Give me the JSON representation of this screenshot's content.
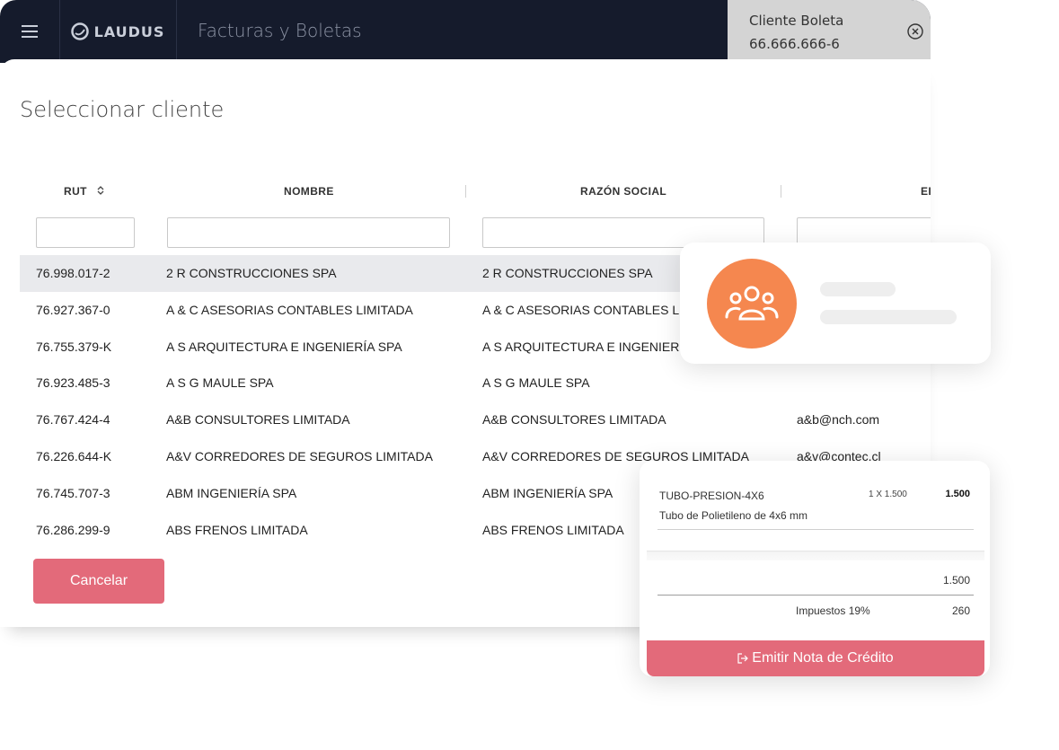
{
  "app": {
    "brand": "LAUDUS",
    "title": "Facturas y Boletas",
    "client_pill": {
      "name": "Cliente Boleta",
      "rut": "66.666.666-6"
    }
  },
  "modal": {
    "title": "Seleccionar cliente",
    "columns": {
      "rut": "RUT",
      "nombre": "NOMBRE",
      "razon": "RAZÓN SOCIAL",
      "email": "EI"
    },
    "rows": [
      {
        "rut": "76.998.017-2",
        "nombre": "2 R CONSTRUCCIONES SPA",
        "razon": "2 R CONSTRUCCIONES SPA",
        "email": ""
      },
      {
        "rut": "76.927.367-0",
        "nombre": "A & C ASESORIAS CONTABLES LIMITADA",
        "razon": "A & C ASESORIAS CONTABLES LIMITADA",
        "email": ""
      },
      {
        "rut": "76.755.379-K",
        "nombre": "A S ARQUITECTURA E INGENIERÍA SPA",
        "razon": "A S ARQUITECTURA E INGENIERÍA SPA",
        "email": ""
      },
      {
        "rut": "76.923.485-3",
        "nombre": "A S G MAULE SPA",
        "razon": "A S G MAULE SPA",
        "email": ""
      },
      {
        "rut": "76.767.424-4",
        "nombre": "A&B CONSULTORES LIMITADA",
        "razon": "A&B CONSULTORES LIMITADA",
        "email": "a&b@nch.com"
      },
      {
        "rut": "76.226.644-K",
        "nombre": "A&V CORREDORES DE SEGUROS LIMITADA",
        "razon": "A&V CORREDORES DE SEGUROS LIMITADA",
        "email": "a&v@contec.cl"
      },
      {
        "rut": "76.745.707-3",
        "nombre": "ABM INGENIERÍA SPA",
        "razon": "ABM INGENIERÍA SPA",
        "email": ""
      },
      {
        "rut": "76.286.299-9",
        "nombre": "ABS FRENOS LIMITADA",
        "razon": "ABS FRENOS LIMITADA",
        "email": ""
      }
    ],
    "cancel_label": "Cancelar"
  },
  "invoice_card": {
    "item_code": "TUBO-PRESION-4X6",
    "item_qty": "1 X 1.500",
    "item_total": "1.500",
    "item_desc": "Tubo de Polietileno de 4x6 mm",
    "subtotal": "1.500",
    "tax_label": "Impuestos 19%",
    "tax_value": "260",
    "emit_label": "Emitir Nota de Crédito"
  },
  "colors": {
    "topbar": "#151b2c",
    "accent_pink": "#e36a7a",
    "avatar_orange": "#f5874f"
  },
  "icons": [
    "menu-icon",
    "laudus-logo-icon",
    "close-circle-icon",
    "sort-icon",
    "users-icon",
    "exit-icon"
  ]
}
